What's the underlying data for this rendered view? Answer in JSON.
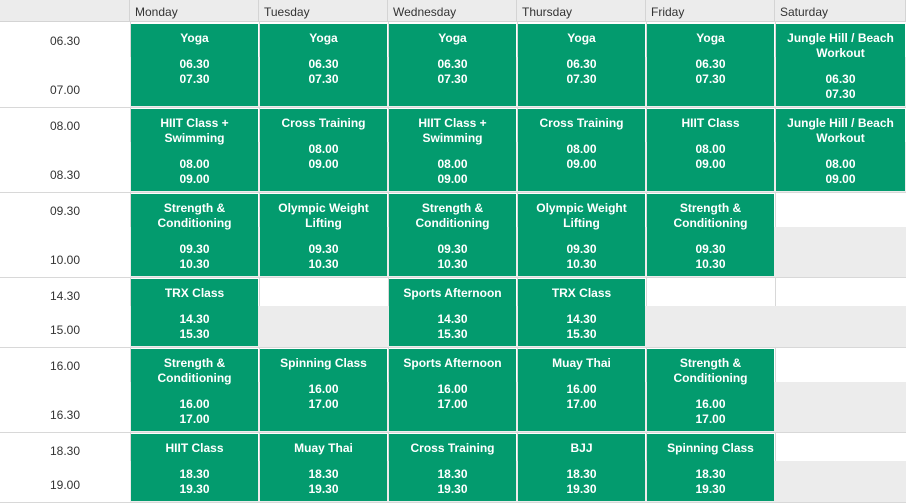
{
  "days": [
    "Monday",
    "Tuesday",
    "Wednesday",
    "Thursday",
    "Friday",
    "Saturday"
  ],
  "slots": [
    {
      "times": [
        "06.30",
        "07.00"
      ],
      "classes": [
        {
          "day": 0,
          "name": "Yoga",
          "start": "06.30",
          "end": "07.30"
        },
        {
          "day": 1,
          "name": "Yoga",
          "start": "06.30",
          "end": "07.30"
        },
        {
          "day": 2,
          "name": "Yoga",
          "start": "06.30",
          "end": "07.30"
        },
        {
          "day": 3,
          "name": "Yoga",
          "start": "06.30",
          "end": "07.30"
        },
        {
          "day": 4,
          "name": "Yoga",
          "start": "06.30",
          "end": "07.30"
        },
        {
          "day": 5,
          "name": "Jungle Hill / Beach Workout",
          "start": "06.30",
          "end": "07.30"
        }
      ]
    },
    {
      "times": [
        "08.00",
        "08.30"
      ],
      "classes": [
        {
          "day": 0,
          "name": "HIIT Class + Swimming",
          "start": "08.00",
          "end": "09.00"
        },
        {
          "day": 1,
          "name": "Cross Training",
          "start": "08.00",
          "end": "09.00"
        },
        {
          "day": 2,
          "name": "HIIT Class + Swimming",
          "start": "08.00",
          "end": "09.00"
        },
        {
          "day": 3,
          "name": "Cross Training",
          "start": "08.00",
          "end": "09.00"
        },
        {
          "day": 4,
          "name": "HIIT Class",
          "start": "08.00",
          "end": "09.00"
        },
        {
          "day": 5,
          "name": "Jungle Hill / Beach Workout",
          "start": "08.00",
          "end": "09.00"
        }
      ]
    },
    {
      "times": [
        "09.30",
        "10.00"
      ],
      "classes": [
        {
          "day": 0,
          "name": "Strength & Conditioning",
          "start": "09.30",
          "end": "10.30"
        },
        {
          "day": 1,
          "name": "Olympic Weight Lifting",
          "start": "09.30",
          "end": "10.30"
        },
        {
          "day": 2,
          "name": "Strength & Conditioning",
          "start": "09.30",
          "end": "10.30"
        },
        {
          "day": 3,
          "name": "Olympic Weight Lifting",
          "start": "09.30",
          "end": "10.30"
        },
        {
          "day": 4,
          "name": "Strength & Conditioning",
          "start": "09.30",
          "end": "10.30"
        }
      ]
    },
    {
      "times": [
        "14.30",
        "15.00"
      ],
      "classes": [
        {
          "day": 0,
          "name": "TRX Class",
          "start": "14.30",
          "end": "15.30"
        },
        {
          "day": 2,
          "name": "Sports Afternoon",
          "start": "14.30",
          "end": "15.30"
        },
        {
          "day": 3,
          "name": "TRX Class",
          "start": "14.30",
          "end": "15.30"
        }
      ]
    },
    {
      "times": [
        "16.00",
        "16.30"
      ],
      "classes": [
        {
          "day": 0,
          "name": "Strength & Conditioning",
          "start": "16.00",
          "end": "17.00"
        },
        {
          "day": 1,
          "name": "Spinning Class",
          "start": "16.00",
          "end": "17.00"
        },
        {
          "day": 2,
          "name": "Sports Afternoon",
          "start": "16.00",
          "end": "17.00"
        },
        {
          "day": 3,
          "name": "Muay Thai",
          "start": "16.00",
          "end": "17.00"
        },
        {
          "day": 4,
          "name": "Strength & Conditioning",
          "start": "16.00",
          "end": "17.00"
        }
      ]
    },
    {
      "times": [
        "18.30",
        "19.00"
      ],
      "classes": [
        {
          "day": 0,
          "name": "HIIT Class",
          "start": "18.30",
          "end": "19.30"
        },
        {
          "day": 1,
          "name": "Muay Thai",
          "start": "18.30",
          "end": "19.30"
        },
        {
          "day": 2,
          "name": "Cross Training",
          "start": "18.30",
          "end": "19.30"
        },
        {
          "day": 3,
          "name": "BJJ",
          "start": "18.30",
          "end": "19.30"
        },
        {
          "day": 4,
          "name": "Spinning Class",
          "start": "18.30",
          "end": "19.30"
        }
      ]
    }
  ],
  "colors": {
    "event": "#039b6e",
    "header": "#ececec",
    "band": "#ececec",
    "border": "#d8d8d8"
  }
}
